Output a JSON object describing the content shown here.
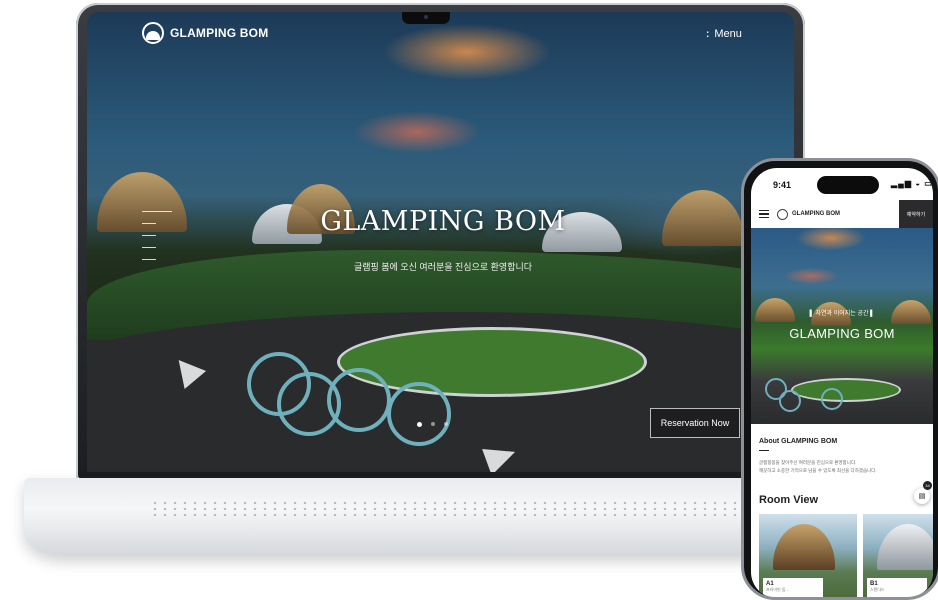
{
  "desktop_site": {
    "logo_text": "GLAMPING BOM",
    "menu_dots": ":",
    "menu_label": "Menu",
    "hero_title": "GLAMPING BOM",
    "hero_subtitle": "글램핑 봄에 오신 여러분을 진심으로 환영합니다",
    "reserve_button": "Reservation Now",
    "slider_dots": 3,
    "active_dot": 0
  },
  "mobile_site": {
    "status_time": "9:41",
    "status_icons": "▂▄▆ ◒ ▭",
    "logo_text": "GLAMPING BOM",
    "reserve_button": "예약하기",
    "hero_tag": "▌ 자연과 이어지는 공간 ▌",
    "hero_title": "GLAMPING BOM",
    "about_title": "About GLAMPING BOM",
    "about_text_1": "글램핑봄을 찾아주신 여러분을 진심으로 환영합니다.",
    "about_text_2": "깨끗하고 소중한 기억으로 남을 수 있도록 최선을 다하겠습니다.",
    "room_view_title": "Room View",
    "fab_badge": "34",
    "fab_icon": "book-icon",
    "rooms": [
      {
        "name": "A1",
        "sub": "프라이빗 돔..."
      },
      {
        "name": "B1",
        "sub": "스탠다드"
      }
    ]
  },
  "colors": {
    "accent_dark": "#2b2b2d",
    "bike_teal": "#6fb0bd",
    "sky_orange": "#e8924a"
  }
}
